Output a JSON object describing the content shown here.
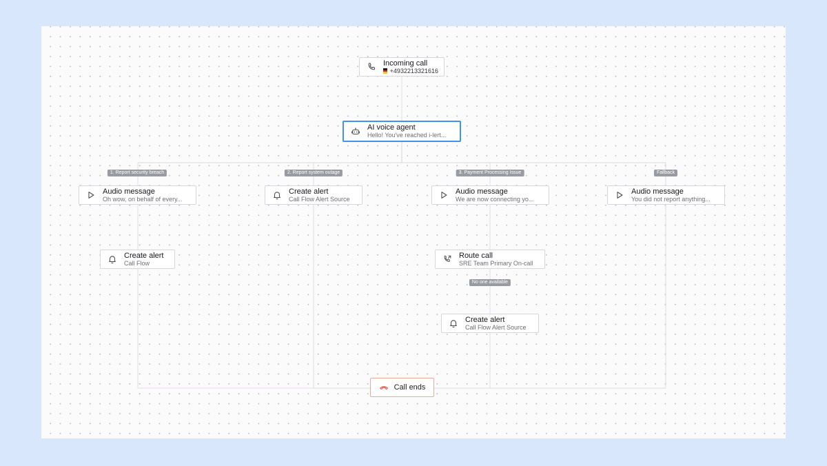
{
  "flow": {
    "start": {
      "title": "Incoming call",
      "phone": "+4932213321616",
      "flag": "Germany"
    },
    "agent": {
      "title": "AI voice agent",
      "greeting": "Hello! You've reached i-lert..."
    },
    "branches": [
      {
        "label": "1. Report security breach",
        "step1": {
          "title": "Audio message",
          "sub": "Oh wow, on behalf of every..."
        },
        "step2": {
          "title": "Create alert",
          "sub": "Call Flow"
        }
      },
      {
        "label": "2. Report system outage",
        "step1": {
          "title": "Create alert",
          "sub": "Call Flow Alert Source"
        }
      },
      {
        "label": "3. Payment Processing Issue",
        "step1": {
          "title": "Audio message",
          "sub": "We are now connecting yo..."
        },
        "step2": {
          "title": "Route call",
          "sub": "SRE Team Primary On-call"
        },
        "condition": "No one available",
        "step3": {
          "title": "Create alert",
          "sub": "Call Flow Alert Source"
        }
      },
      {
        "label": "Fallback",
        "step1": {
          "title": "Audio message",
          "sub": "You did not report anything..."
        }
      }
    ],
    "end": {
      "title": "Call ends"
    }
  },
  "icons": {
    "start": "phone-icon",
    "agent": "robot-icon",
    "audio": "play-icon",
    "alert": "bell-icon",
    "route": "phone-forward-icon",
    "end": "hang-up-icon"
  },
  "colors": {
    "page_background": "#d8e7fb",
    "selected_border": "#3d92f2",
    "end_border": "#f0a79d",
    "end_icon": "#e0503c",
    "badge": "#9a9ba2"
  }
}
